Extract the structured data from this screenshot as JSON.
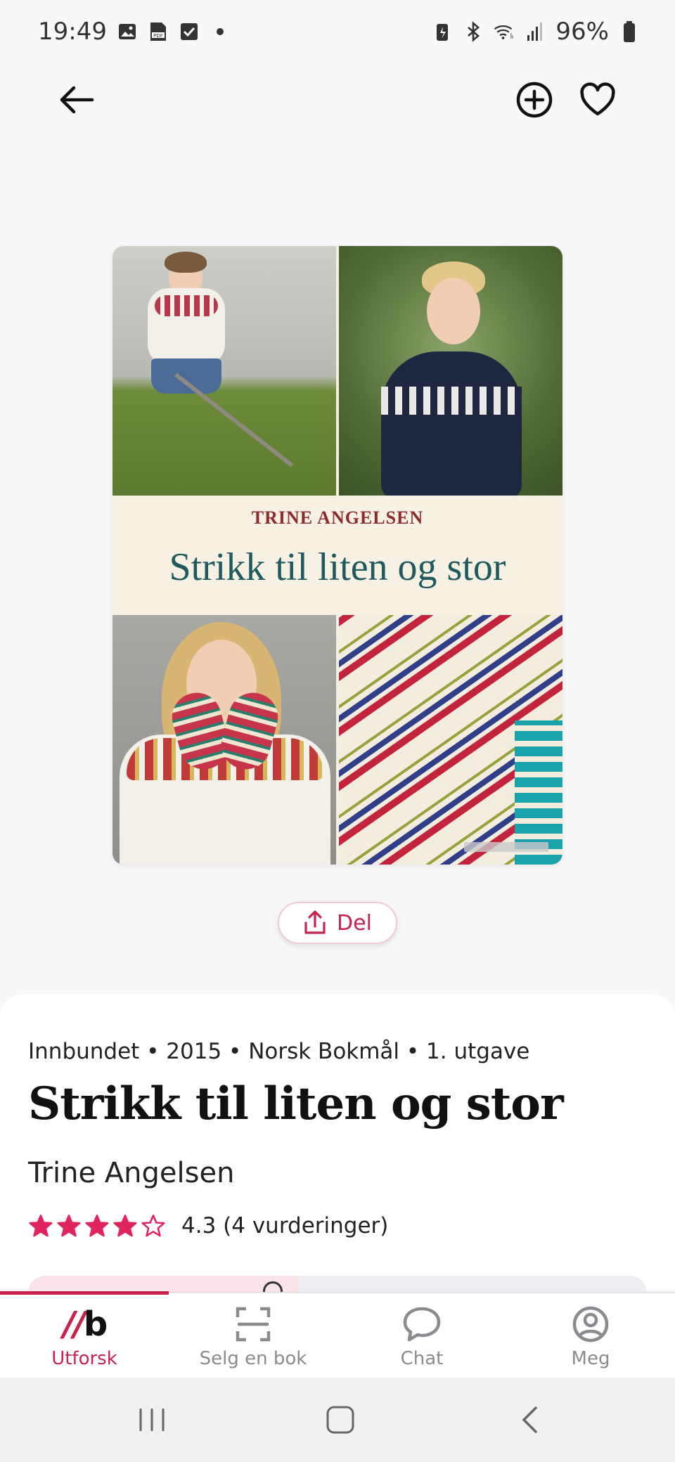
{
  "status_bar": {
    "time": "19:49",
    "battery": "96%",
    "left_icons": [
      "image-icon",
      "pdf-icon",
      "checkbox-icon",
      "dot-icon"
    ],
    "right_icons": [
      "battery-saver-icon",
      "bluetooth-icon",
      "wifi-icon",
      "signal-icon",
      "battery-icon"
    ]
  },
  "app_bar": {
    "icons": [
      "back-arrow-icon",
      "add-circle-icon",
      "heart-icon"
    ]
  },
  "cover": {
    "author": "TRINE ANGELSEN",
    "title": "Strikk til liten og stor"
  },
  "share": {
    "label": "Del"
  },
  "book": {
    "meta": "Innbundet • 2015 • Norsk Bokmål • 1. utgave",
    "title": "Strikk til liten og stor",
    "author": "Trine Angelsen",
    "rating_value": 4.3,
    "rating_text": "4.3 (4 vurderinger)",
    "stars_filled": 4,
    "stars_total": 5
  },
  "bottom_nav": {
    "items": [
      {
        "label": "Utforsk",
        "icon": "brand-logo-icon",
        "active": true
      },
      {
        "label": "Selg en bok",
        "icon": "scan-icon",
        "active": false
      },
      {
        "label": "Chat",
        "icon": "chat-bubble-icon",
        "active": false
      },
      {
        "label": "Meg",
        "icon": "profile-icon",
        "active": false
      }
    ],
    "logo_slashes": "//",
    "logo_letter": "b"
  },
  "colors": {
    "accent": "#c8224e",
    "star": "#e0245e",
    "background": "#f8f7f9"
  }
}
